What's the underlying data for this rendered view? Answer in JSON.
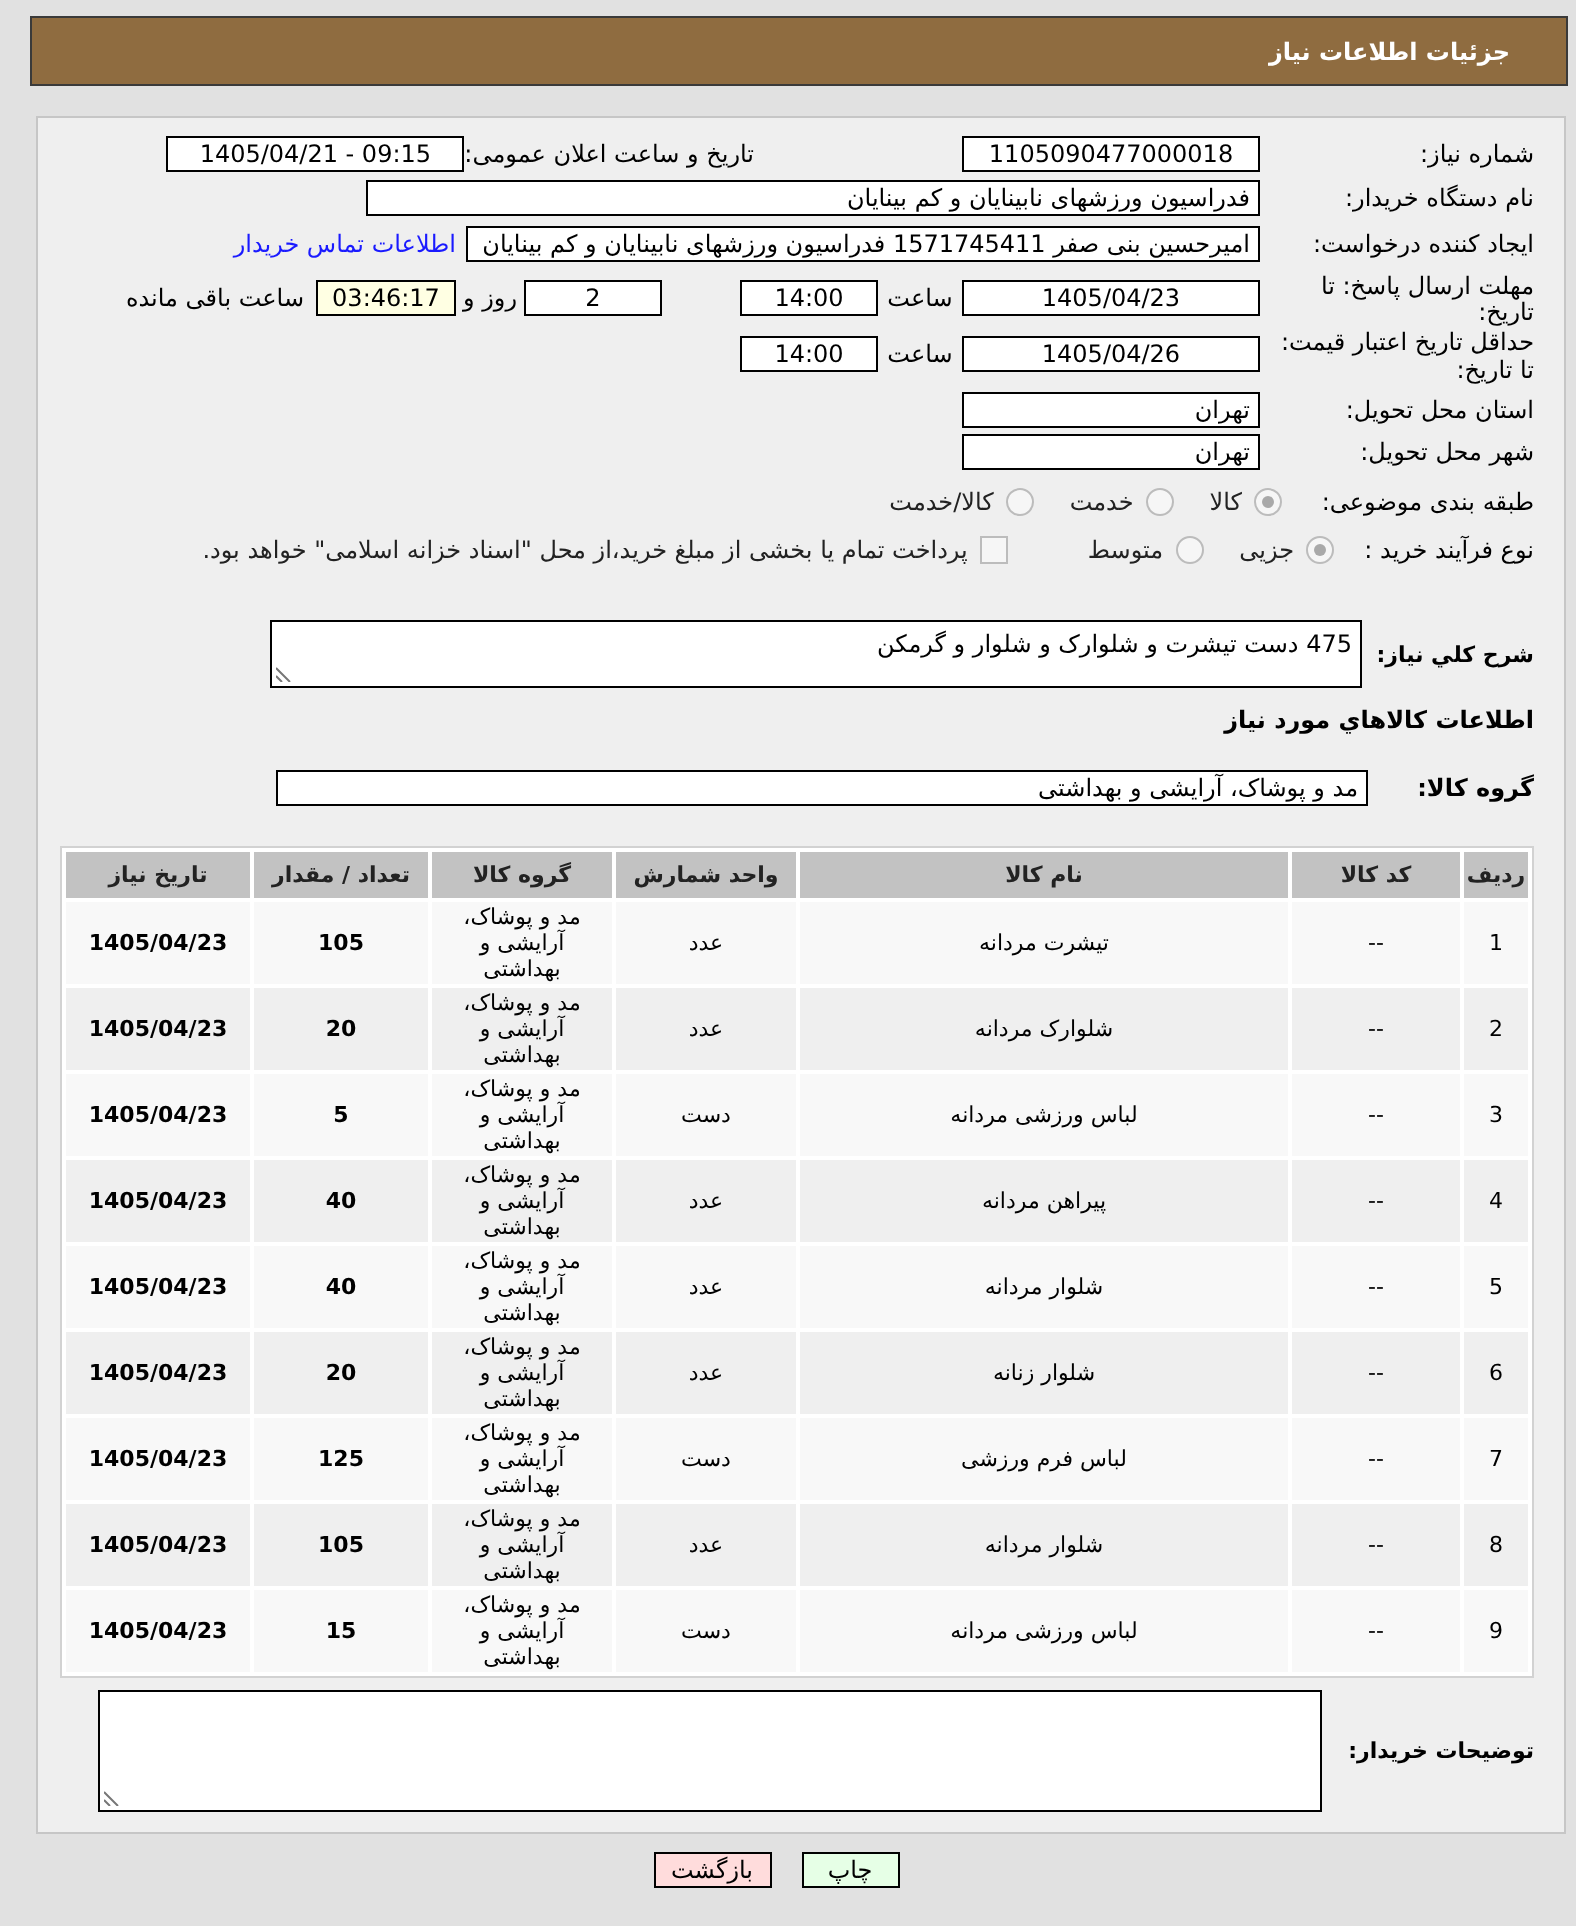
{
  "header": {
    "title": "جزئیات اطلاعات نیاز"
  },
  "need_number": {
    "label": "شماره نیاز:",
    "value": "1105090477000018"
  },
  "announcement": {
    "label": "تاریخ و ساعت اعلان عمومی:",
    "value": "1405/04/21 - 09:15"
  },
  "buyer_org": {
    "label": "نام دستگاه خریدار:",
    "value": "فدراسیون ورزشهای نابینایان و کم بینایان"
  },
  "requester": {
    "label": "ایجاد کننده درخواست:",
    "value": "امیرحسین بنی صفر 1571745411 فدراسیون ورزشهای نابینایان و کم بینایان",
    "link": "اطلاعات تماس خریدار"
  },
  "response_deadline": {
    "label": "مهلت ارسال پاسخ: تا تاریخ:",
    "date": "1405/04/23",
    "time_label": "ساعت",
    "time": "14:00",
    "days": "2",
    "days_label": "روز و",
    "remaining": "03:46:17",
    "remaining_label": "ساعت باقی مانده"
  },
  "price_validity": {
    "label": "حداقل تاریخ اعتبار قیمت: تا تاریخ:",
    "date": "1405/04/26",
    "time_label": "ساعت",
    "time": "14:00"
  },
  "delivery_province": {
    "label": "استان محل تحویل:",
    "value": "تهران"
  },
  "delivery_city": {
    "label": "شهر محل تحویل:",
    "value": "تهران"
  },
  "category": {
    "label": "طبقه بندی موضوعی:",
    "options": [
      {
        "label": "کالا",
        "selected": true
      },
      {
        "label": "خدمت",
        "selected": false
      },
      {
        "label": "کالا/خدمت",
        "selected": false
      }
    ]
  },
  "purchase_type": {
    "label": "نوع فرآیند خرید :",
    "options": [
      {
        "label": "جزیی",
        "selected": true
      },
      {
        "label": "متوسط",
        "selected": false
      }
    ],
    "treasury": {
      "label": "پرداخت تمام یا بخشی از مبلغ خرید،از محل \"اسناد خزانه اسلامی\" خواهد بود.",
      "checked": false
    }
  },
  "description": {
    "label": "شرح کلي نياز:",
    "value": "475 دست تیشرت و شلوارک و شلوار و گرمکن"
  },
  "goods_title": "اطلاعات کالاهاي مورد نياز",
  "goods_group": {
    "label": "گروه کالا:",
    "value": "مد و پوشاک، آرایشی و بهداشتی"
  },
  "table": {
    "columns": [
      "ردیف",
      "کد کالا",
      "نام کالا",
      "واحد شمارش",
      "گروه کالا",
      "تعداد / مقدار",
      "تاریخ نیاز"
    ],
    "rows": [
      [
        "1",
        "--",
        "تیشرت مردانه",
        "عدد",
        "مد و پوشاک، آرایشی و بهداشتی",
        "105",
        "1405/04/23"
      ],
      [
        "2",
        "--",
        "شلوارک مردانه",
        "عدد",
        "مد و پوشاک، آرایشی و بهداشتی",
        "20",
        "1405/04/23"
      ],
      [
        "3",
        "--",
        "لباس ورزشی مردانه",
        "دست",
        "مد و پوشاک، آرایشی و بهداشتی",
        "5",
        "1405/04/23"
      ],
      [
        "4",
        "--",
        "پیراهن مردانه",
        "عدد",
        "مد و پوشاک، آرایشی و بهداشتی",
        "40",
        "1405/04/23"
      ],
      [
        "5",
        "--",
        "شلوار مردانه",
        "عدد",
        "مد و پوشاک، آرایشی و بهداشتی",
        "40",
        "1405/04/23"
      ],
      [
        "6",
        "--",
        "شلوار زنانه",
        "عدد",
        "مد و پوشاک، آرایشی و بهداشتی",
        "20",
        "1405/04/23"
      ],
      [
        "7",
        "--",
        "لباس فرم ورزشی",
        "دست",
        "مد و پوشاک، آرایشی و بهداشتی",
        "125",
        "1405/04/23"
      ],
      [
        "8",
        "--",
        "شلوار مردانه",
        "عدد",
        "مد و پوشاک، آرایشی و بهداشتی",
        "105",
        "1405/04/23"
      ],
      [
        "9",
        "--",
        "لباس ورزشی مردانه",
        "دست",
        "مد و پوشاک، آرایشی و بهداشتی",
        "15",
        "1405/04/23"
      ]
    ]
  },
  "buyer_notes": {
    "label": "توضیحات خریدار:"
  },
  "buttons": [
    {
      "label": "چاپ",
      "kind": "print"
    },
    {
      "label": "بازگشت",
      "kind": "back"
    }
  ]
}
